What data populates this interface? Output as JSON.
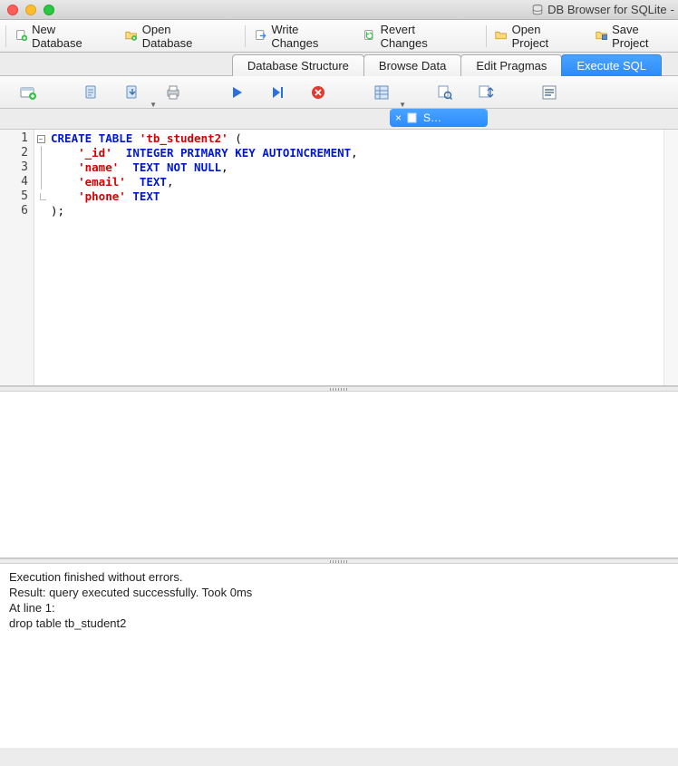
{
  "window": {
    "title": "DB Browser for SQLite"
  },
  "toolbar": {
    "new_db": "New Database",
    "open_db": "Open Database",
    "write_changes": "Write Changes",
    "revert_changes": "Revert Changes",
    "open_project": "Open Project",
    "save_project": "Save Project"
  },
  "tabs": {
    "structure": "Database Structure",
    "browse": "Browse Data",
    "pragmas": "Edit Pragmas",
    "exec": "Execute SQL"
  },
  "subtab": {
    "label": "S…"
  },
  "code": {
    "lines": [
      {
        "n": "1"
      },
      {
        "n": "2"
      },
      {
        "n": "3"
      },
      {
        "n": "4"
      },
      {
        "n": "5"
      },
      {
        "n": "6"
      }
    ],
    "l1_kw1": "CREATE TABLE ",
    "l1_str": "'tb_student2'",
    "l1_p": " (",
    "l2_str": "'_id'",
    "l2_kw": "  INTEGER PRIMARY KEY AUTOINCREMENT",
    "l2_p": ",",
    "l3_str": "'name'",
    "l3_kw": "  TEXT NOT NULL",
    "l3_p": ",",
    "l4_str": "'email'",
    "l4_kw": "  TEXT",
    "l4_p": ",",
    "l5_str": "'phone'",
    "l5_kw": " TEXT",
    "l6": ");"
  },
  "status": {
    "line1": "Execution finished without errors.",
    "line2": "Result: query executed successfully. Took 0ms",
    "line3": "At line 1:",
    "line4": "drop table tb_student2"
  }
}
